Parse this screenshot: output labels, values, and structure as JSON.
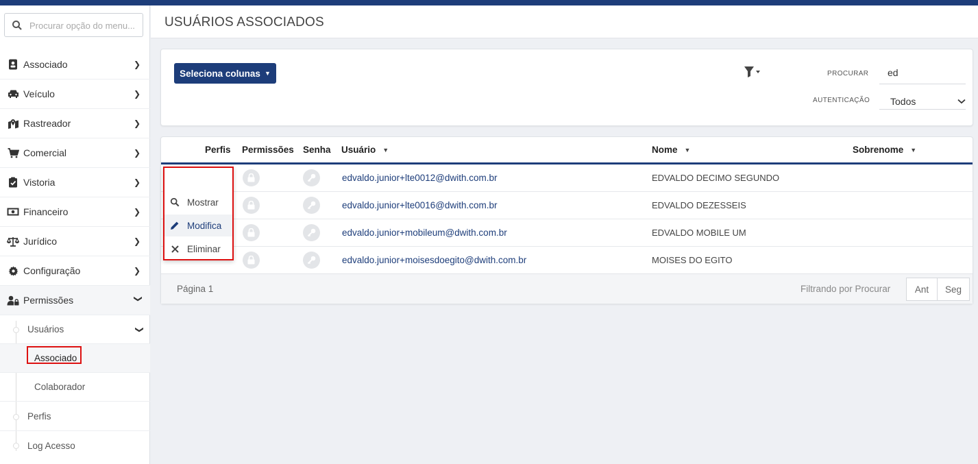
{
  "sidebar": {
    "search_placeholder": "Procurar opção do menu...",
    "items": [
      {
        "label": "Associado",
        "icon": "id-badge-icon"
      },
      {
        "label": "Veículo",
        "icon": "car-icon"
      },
      {
        "label": "Rastreador",
        "icon": "map-pin-icon"
      },
      {
        "label": "Comercial",
        "icon": "cart-icon"
      },
      {
        "label": "Vistoria",
        "icon": "clipboard-check-icon"
      },
      {
        "label": "Financeiro",
        "icon": "money-icon"
      },
      {
        "label": "Jurídico",
        "icon": "scale-icon"
      },
      {
        "label": "Configuração",
        "icon": "gear-icon"
      },
      {
        "label": "Permissões",
        "icon": "user-lock-icon"
      }
    ],
    "sub_items": {
      "usuarios": "Usuários",
      "associado": "Associado",
      "colaborador": "Colaborador",
      "perfis": "Perfis",
      "log_acesso": "Log Acesso"
    }
  },
  "header": {
    "title": "USUÁRIOS ASSOCIADOS"
  },
  "filters": {
    "select_columns_label": "Seleciona colunas",
    "search_label": "PROCURAR",
    "search_value": "ed",
    "auth_label": "AUTENTICAÇÃO",
    "auth_value": "Todos"
  },
  "table": {
    "headers": {
      "perfis": "Perfis",
      "permissoes": "Permissões",
      "senha": "Senha",
      "usuario": "Usuário",
      "nome": "Nome",
      "sobrenome": "Sobrenome"
    },
    "rows": [
      {
        "usuario": "edvaldo.junior+lte0012@dwith.com.br",
        "nome": "EDVALDO DECIMO SEGUNDO"
      },
      {
        "usuario": "edvaldo.junior+lte0016@dwith.com.br",
        "nome": "EDVALDO DEZESSEIS"
      },
      {
        "usuario": "edvaldo.junior+mobileum@dwith.com.br",
        "nome": "EDVALDO MOBILE UM"
      },
      {
        "usuario": "edvaldo.junior+moisesdoegito@dwith.com.br",
        "nome": "MOISES DO EGITO"
      }
    ],
    "footer": {
      "page": "Página 1",
      "filter_info": "Filtrando por Procurar",
      "prev": "Ant",
      "next": "Seg"
    }
  },
  "row_menu": {
    "items": [
      {
        "label": "Mostrar",
        "icon": "search-icon"
      },
      {
        "label": "Modifica",
        "icon": "pencil-icon"
      },
      {
        "label": "Eliminar",
        "icon": "close-icon"
      }
    ]
  },
  "colors": {
    "primary": "#1d3d7a",
    "highlight": "#dd1111"
  }
}
